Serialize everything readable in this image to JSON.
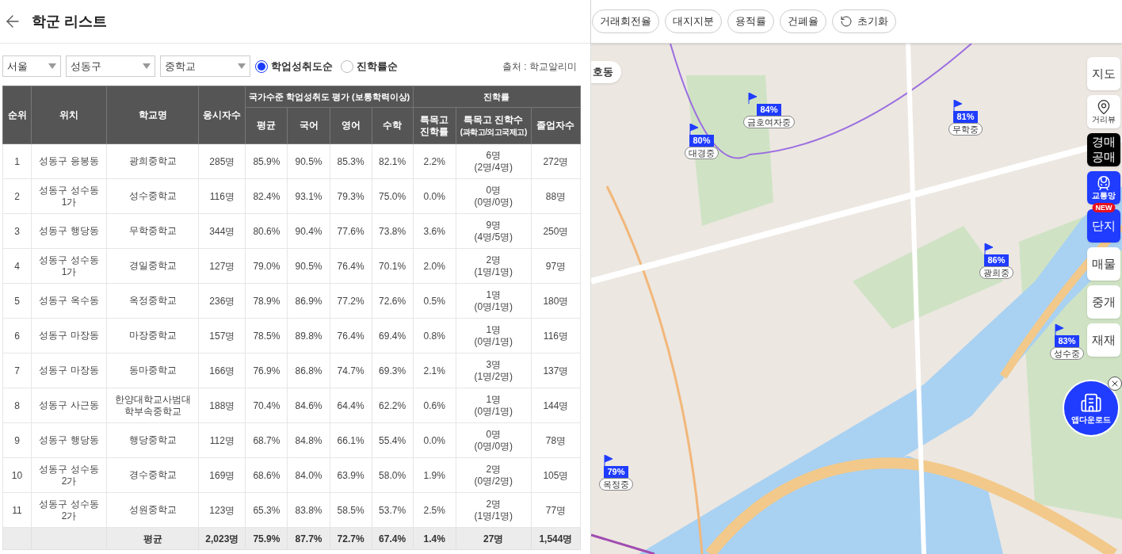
{
  "header": {
    "title": "학군 리스트"
  },
  "filters": {
    "selects": [
      {
        "value": "서울"
      },
      {
        "value": "성동구"
      },
      {
        "value": "중학교"
      }
    ],
    "sort_options": [
      {
        "label": "학업성취도순",
        "selected": true
      },
      {
        "label": "진학률순",
        "selected": false
      }
    ],
    "source": "출처 : 학교알리미"
  },
  "table": {
    "group_headers": [
      {
        "label": "국가수준 학업성취도 평가 (보통학력이상)"
      },
      {
        "label": "진학률"
      }
    ],
    "columns": [
      {
        "label": "순위"
      },
      {
        "label": "위치"
      },
      {
        "label": "학교명"
      },
      {
        "label": "응시자수"
      },
      {
        "label": "평균"
      },
      {
        "label": "국어"
      },
      {
        "label": "영어"
      },
      {
        "label": "수학"
      },
      {
        "label": "특목고 진학률"
      },
      {
        "label": "특목고 진학수",
        "note": "(과학고/외고국제고)"
      },
      {
        "label": "졸업자수"
      }
    ],
    "rows": [
      {
        "rank": "1",
        "location": "성동구 응봉동",
        "school": "광희중학교",
        "examinees": "285명",
        "average": "85.9%",
        "korean": "90.5%",
        "english": "85.3%",
        "math": "82.1%",
        "special_rate": "2.2%",
        "special_count": "6명",
        "special_breakdown": "(2명/4명)",
        "graduates": "272명"
      },
      {
        "rank": "2",
        "location": "성동구 성수동1가",
        "school": "성수중학교",
        "examinees": "116명",
        "average": "82.4%",
        "korean": "93.1%",
        "english": "79.3%",
        "math": "75.0%",
        "special_rate": "0.0%",
        "special_count": "0명",
        "special_breakdown": "(0명/0명)",
        "graduates": "88명"
      },
      {
        "rank": "3",
        "location": "성동구 행당동",
        "school": "무학중학교",
        "examinees": "344명",
        "average": "80.6%",
        "korean": "90.4%",
        "english": "77.6%",
        "math": "73.8%",
        "special_rate": "3.6%",
        "special_count": "9명",
        "special_breakdown": "(4명/5명)",
        "graduates": "250명"
      },
      {
        "rank": "4",
        "location": "성동구 성수동1가",
        "school": "경일중학교",
        "examinees": "127명",
        "average": "79.0%",
        "korean": "90.5%",
        "english": "76.4%",
        "math": "70.1%",
        "special_rate": "2.0%",
        "special_count": "2명",
        "special_breakdown": "(1명/1명)",
        "graduates": "97명"
      },
      {
        "rank": "5",
        "location": "성동구 옥수동",
        "school": "옥정중학교",
        "examinees": "236명",
        "average": "78.9%",
        "korean": "86.9%",
        "english": "77.2%",
        "math": "72.6%",
        "special_rate": "0.5%",
        "special_count": "1명",
        "special_breakdown": "(0명/1명)",
        "graduates": "180명"
      },
      {
        "rank": "6",
        "location": "성동구 마장동",
        "school": "마장중학교",
        "examinees": "157명",
        "average": "78.5%",
        "korean": "89.8%",
        "english": "76.4%",
        "math": "69.4%",
        "special_rate": "0.8%",
        "special_count": "1명",
        "special_breakdown": "(0명/1명)",
        "graduates": "116명"
      },
      {
        "rank": "7",
        "location": "성동구 마장동",
        "school": "동마중학교",
        "examinees": "166명",
        "average": "76.9%",
        "korean": "86.8%",
        "english": "74.7%",
        "math": "69.3%",
        "special_rate": "2.1%",
        "special_count": "3명",
        "special_breakdown": "(1명/2명)",
        "graduates": "137명"
      },
      {
        "rank": "8",
        "location": "성동구 사근동",
        "school": "한양대학교사범대학부속중학교",
        "examinees": "188명",
        "average": "70.4%",
        "korean": "84.6%",
        "english": "64.4%",
        "math": "62.2%",
        "special_rate": "0.6%",
        "special_count": "1명",
        "special_breakdown": "(0명/1명)",
        "graduates": "144명"
      },
      {
        "rank": "9",
        "location": "성동구 행당동",
        "school": "행당중학교",
        "examinees": "112명",
        "average": "68.7%",
        "korean": "84.8%",
        "english": "66.1%",
        "math": "55.4%",
        "special_rate": "0.0%",
        "special_count": "0명",
        "special_breakdown": "(0명/0명)",
        "graduates": "78명"
      },
      {
        "rank": "10",
        "location": "성동구 성수동2가",
        "school": "경수중학교",
        "examinees": "169명",
        "average": "68.6%",
        "korean": "84.0%",
        "english": "63.9%",
        "math": "58.0%",
        "special_rate": "1.9%",
        "special_count": "2명",
        "special_breakdown": "(0명/2명)",
        "graduates": "105명"
      },
      {
        "rank": "11",
        "location": "성동구 성수동2가",
        "school": "성원중학교",
        "examinees": "123명",
        "average": "65.3%",
        "korean": "83.8%",
        "english": "58.5%",
        "math": "53.7%",
        "special_rate": "2.5%",
        "special_count": "2명",
        "special_breakdown": "(1명/1명)",
        "graduates": "77명"
      }
    ],
    "footer": {
      "label": "평균",
      "examinees": "2,023명",
      "average": "75.9%",
      "korean": "87.7%",
      "english": "72.7%",
      "math": "67.4%",
      "special_rate": "1.4%",
      "special_count": "27명",
      "graduates": "1,544명"
    }
  },
  "map": {
    "chips": [
      {
        "label": "거래회전율",
        "kind": "filter"
      },
      {
        "label": "대지지분",
        "kind": "filter"
      },
      {
        "label": "용적률",
        "kind": "filter"
      },
      {
        "label": "건폐율",
        "kind": "filter"
      },
      {
        "label": "초기화",
        "kind": "reset"
      }
    ],
    "area_chip": "호동",
    "markers": [
      {
        "percent": "84%",
        "name": "금호여자중"
      },
      {
        "percent": "80%",
        "name": "대경중"
      },
      {
        "percent": "81%",
        "name": "무학중"
      },
      {
        "percent": "86%",
        "name": "광희중"
      },
      {
        "percent": "83%",
        "name": "성수중"
      },
      {
        "percent": "79%",
        "name": "옥정중"
      }
    ],
    "side_buttons": [
      {
        "label": "지도",
        "kind": "text",
        "on": false
      },
      {
        "label": "거리뷰",
        "kind": "pin",
        "on": false
      },
      {
        "label": "경매 공매",
        "kind": "dark",
        "on": false
      },
      {
        "label": "교통망",
        "kind": "train",
        "on": true
      },
      {
        "label": "단지",
        "kind": "text",
        "on": true,
        "badge": "NEW"
      },
      {
        "label": "매물",
        "kind": "text",
        "on": false
      },
      {
        "label": "중개",
        "kind": "text",
        "on": false
      },
      {
        "label": "재재",
        "kind": "text",
        "on": false
      }
    ],
    "app_download": {
      "label": "앱다운로드"
    }
  }
}
